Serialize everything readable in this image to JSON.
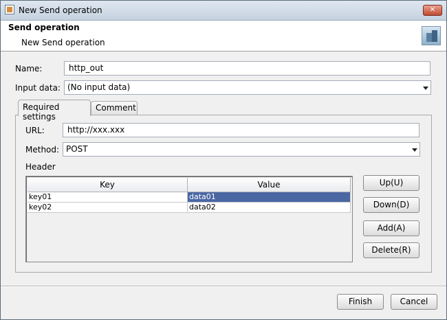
{
  "window": {
    "title": "New Send operation",
    "close_glyph": "✕"
  },
  "header": {
    "title": "Send operation",
    "subtitle": "New Send operation",
    "icon": "server-icon"
  },
  "form": {
    "name_label": "Name:",
    "name_value": "http_out",
    "input_label": "Input data:",
    "input_value": "(No input data)"
  },
  "tabs": [
    {
      "label": "Required settings",
      "active": true
    },
    {
      "label": "Comment",
      "active": false
    }
  ],
  "settings": {
    "url_label": "URL:",
    "url_value": "http://xxx.xxx",
    "method_label": "Method:",
    "method_value": "POST",
    "header_label": "Header"
  },
  "table": {
    "columns": [
      "Key",
      "Value"
    ],
    "rows": [
      {
        "key": "key01",
        "value": "data01",
        "selected_value": true
      },
      {
        "key": "key02",
        "value": "data02",
        "selected_value": false
      }
    ]
  },
  "buttons": {
    "up": "Up(U)",
    "down": "Down(D)",
    "add": "Add(A)",
    "delete": "Delete(R)",
    "finish": "Finish",
    "cancel": "Cancel"
  },
  "colors": {
    "selection": "#4a67a4",
    "close": "#c04a30"
  }
}
